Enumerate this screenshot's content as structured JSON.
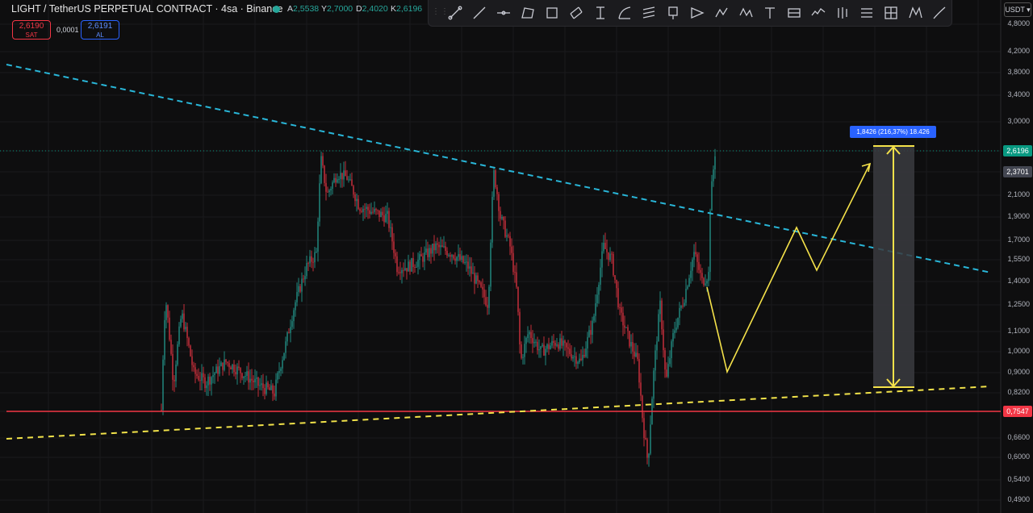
{
  "header": {
    "title": "LIGHT / TetherUS PERPETUAL CONTRACT · 4sa · Binance",
    "ohlc": [
      {
        "k": "A",
        "v": "2,5538"
      },
      {
        "k": "Y",
        "v": "2,7000"
      },
      {
        "k": "D",
        "v": "2,4020"
      },
      {
        "k": "K",
        "v": "2,6196"
      }
    ]
  },
  "order": {
    "sell_price": "2,6190",
    "sell_label": "SAT",
    "spread": "0,0001",
    "buy_price": "2,6191",
    "buy_label": "AL"
  },
  "currency": "USDT ▾",
  "price_axis": [
    {
      "label": "4,8000",
      "p": 4.8
    },
    {
      "label": "4,2000",
      "p": 4.2
    },
    {
      "label": "3,8000",
      "p": 3.8
    },
    {
      "label": "3,4000",
      "p": 3.4
    },
    {
      "label": "3,0000",
      "p": 3.0
    },
    {
      "label": "2,1000",
      "p": 2.1
    },
    {
      "label": "1,9000",
      "p": 1.9
    },
    {
      "label": "1,7000",
      "p": 1.7
    },
    {
      "label": "1,5500",
      "p": 1.55
    },
    {
      "label": "1,4000",
      "p": 1.4
    },
    {
      "label": "1,2500",
      "p": 1.25
    },
    {
      "label": "1,1000",
      "p": 1.1
    },
    {
      "label": "1,0000",
      "p": 1.0
    },
    {
      "label": "0,9000",
      "p": 0.9
    },
    {
      "label": "0,8200",
      "p": 0.82
    },
    {
      "label": "0,6600",
      "p": 0.66
    },
    {
      "label": "0,6000",
      "p": 0.6
    },
    {
      "label": "0,5400",
      "p": 0.54
    },
    {
      "label": "0,4900",
      "p": 0.49
    }
  ],
  "price_tags": [
    {
      "label": "2,6196",
      "p": 2.6196,
      "color": "#089981"
    },
    {
      "label": "2,3701",
      "p": 2.3701,
      "color": "#434651"
    },
    {
      "label": "0,7547",
      "p": 0.7547,
      "color": "#f23645"
    }
  ],
  "measure_label": "1,8426 (216,37%) 18.426",
  "tools": [
    "trend-line-icon",
    "line-icon",
    "horizontal-ray-icon",
    "polygon-icon",
    "rectangle-icon",
    "parallel-channel-icon",
    "price-range-icon",
    "arc-icon",
    "fib-icon",
    "marker-icon",
    "forecast-icon",
    "path-icon",
    "pattern-icon",
    "text-icon",
    "table-icon",
    "wave-icon",
    "candles-icon",
    "list-icon",
    "grid-icon",
    "xabcd-icon",
    "brush-icon"
  ],
  "colors": {
    "up": "#26a69a",
    "down": "#f23645",
    "trend_blue": "#29b6d8",
    "trend_yellow": "#f2e34a",
    "support": "#f23645",
    "projection": "#f5e24a"
  }
}
